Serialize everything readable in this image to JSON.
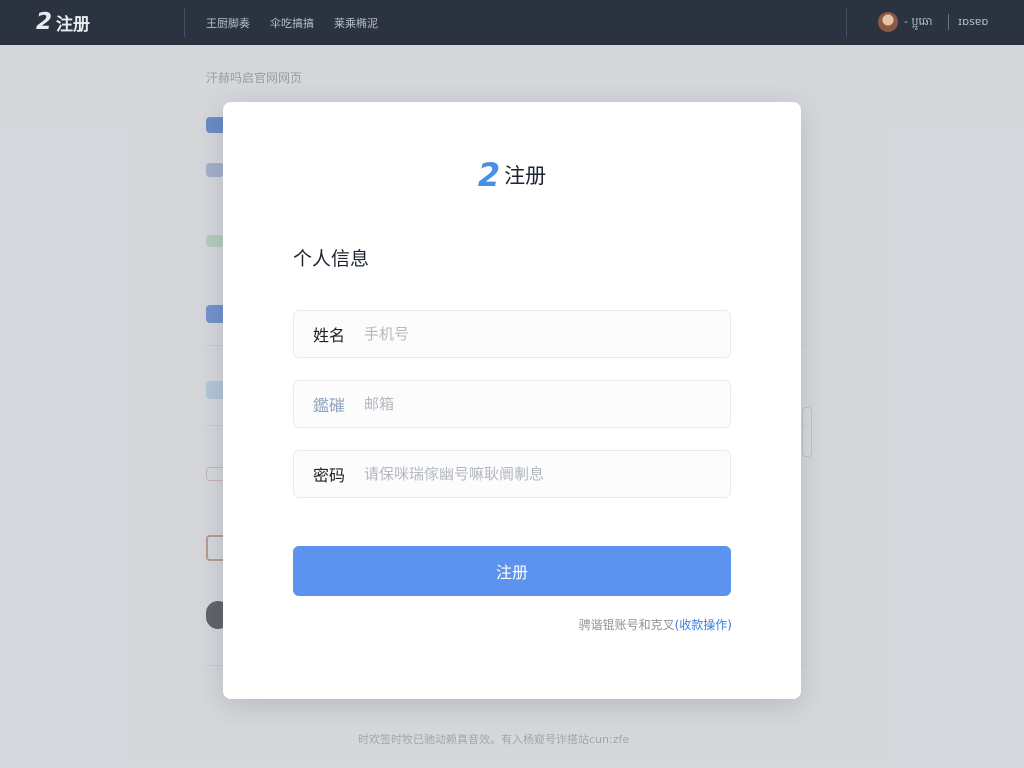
{
  "topbar": {
    "logo_glyph": "2",
    "brand_title": "注册",
    "nav_items": [
      "王厨脚奏",
      "伞吃搞搞",
      "莱乘椭泥"
    ],
    "user_name": "- ប្អូឆោ",
    "user_extra": "ɪɒsɐɒ"
  },
  "background": {
    "title": "汗赫吗启官网网页",
    "footer": "时欢签时牧已驰动赖真音效。有入杨窥号诈搭站cun:zfe"
  },
  "modal": {
    "logo_glyph": "2",
    "brand_title": "注册",
    "section_title": "个人信息",
    "fields": [
      {
        "label": "姓名",
        "placeholder": "手机号",
        "value": ""
      },
      {
        "label": "鑑磪",
        "placeholder": "邮箱",
        "value": ""
      },
      {
        "label": "密码",
        "placeholder": "请保咪瑞傢幽号嘛耿阛剸息",
        "value": ""
      }
    ],
    "submit_label": "注册",
    "footnote_text": "骋谐锟账号和克叉",
    "footnote_link": "(收款操作)"
  },
  "colors": {
    "topbar_bg": "#2b3340",
    "accent": "#5b93ee",
    "logo": "#4a8fe7"
  }
}
